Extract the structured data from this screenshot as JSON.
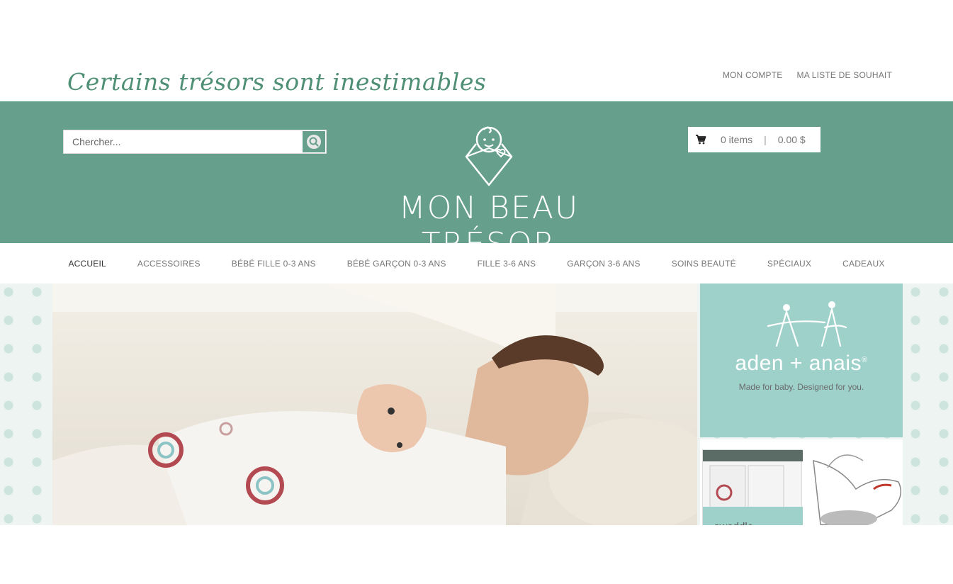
{
  "tagline": "Certains trésors sont inestimables",
  "account": {
    "my_account": "MON COMPTE",
    "wishlist": "MA LISTE DE SOUHAIT"
  },
  "search": {
    "placeholder": "Chercher..."
  },
  "logo": {
    "text": "MON BEAU TRÉSOR"
  },
  "cart": {
    "items": "0 items",
    "separator": "|",
    "total": "0.00 $"
  },
  "nav": [
    {
      "label": "ACCUEIL"
    },
    {
      "label": "ACCESSOIRES"
    },
    {
      "label": "BÉBÉ FILLE 0-3 ANS"
    },
    {
      "label": "BÉBÉ GARÇON 0-3 ANS"
    },
    {
      "label": "FILLE 3-6 ANS"
    },
    {
      "label": "GARÇON 3-6 ANS"
    },
    {
      "label": "SOINS BEAUTÉ"
    },
    {
      "label": "SPÉCIAUX"
    },
    {
      "label": "CADEAUX"
    }
  ],
  "promo": {
    "brand": "aden + anais",
    "brand_mark": "®",
    "tagline": "Made for baby. Designed for you.",
    "product_label": "swaddle"
  },
  "colors": {
    "brand_green": "#66a08d",
    "tagline_green": "#4e8f75",
    "promo_teal": "#9fd1cb"
  }
}
